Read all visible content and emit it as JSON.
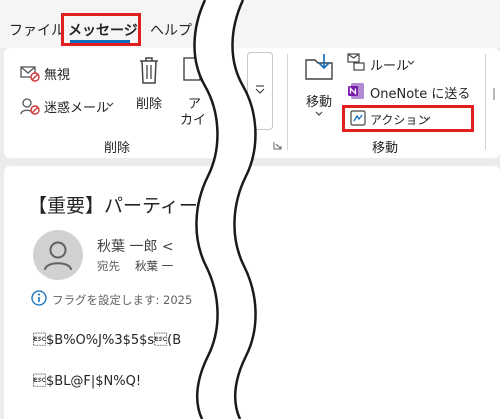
{
  "tabs": {
    "file": "ファイル",
    "message": "メッセージ",
    "help": "ヘルプ"
  },
  "ribbon": {
    "ignore": "無視",
    "junk": "迷惑メール",
    "delete": "削除",
    "archive_line1": "ア",
    "archive_line2": "カイ",
    "group_delete": "削除",
    "move": "移動",
    "rules": "ルール",
    "onenote": "OneNote に送る",
    "actions": "アクション",
    "group_move": "移動"
  },
  "message": {
    "subject": "【重要】パーティー開始",
    "sender": "秋葉 一郎 <",
    "to_label": "宛先",
    "to_name": "秋葉 一",
    "flag_text": "フラグを設定します: 2025",
    "body_line1": "\u001b$B%O%J%3$5$s\u001b(B",
    "body_line2": "\u001b$BL@F|$N%Q!"
  },
  "colors": {
    "highlight_red": "#e02020",
    "accent_blue": "#0f6cbd",
    "onenote_purple": "#7719aa"
  }
}
